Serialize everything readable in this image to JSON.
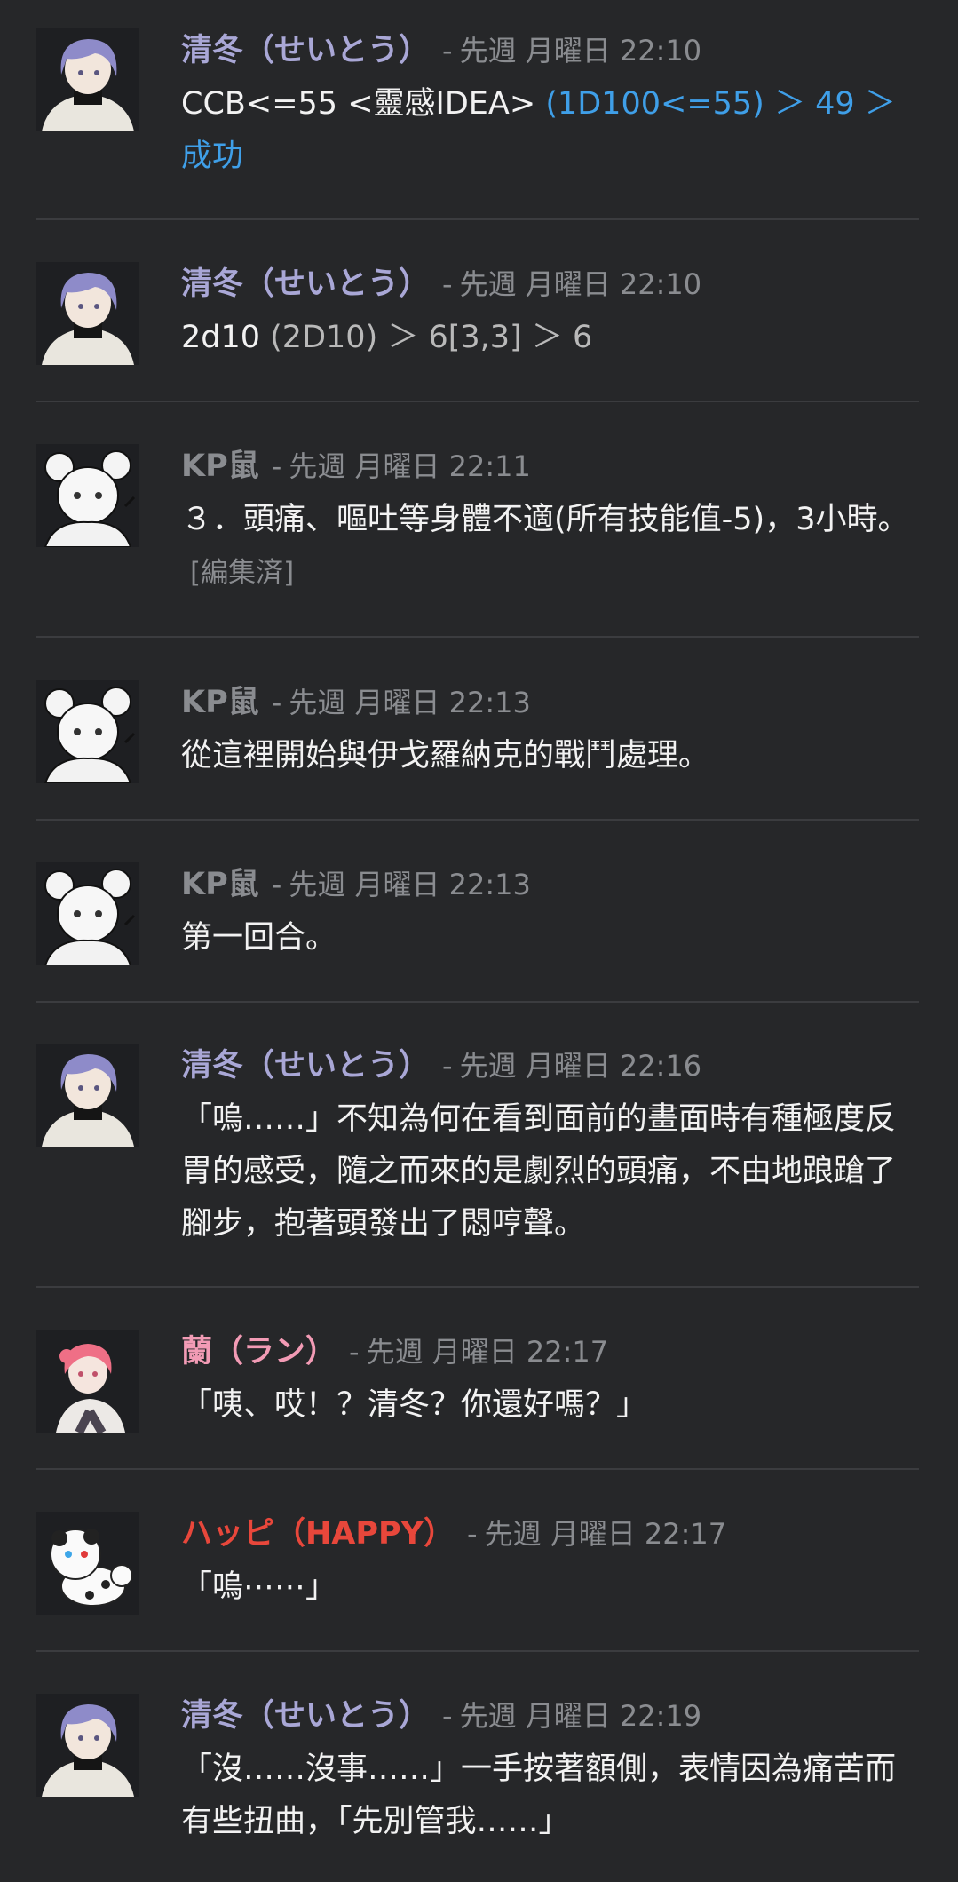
{
  "messages": [
    {
      "author": "清冬（せいとう）",
      "meta_dash": "-",
      "time": "先週 月曜日 22:10",
      "line_plain": "CCB<=55 <靈感IDEA> ",
      "line_roll": "(1D100<=55) ＞ 49 ＞ 成功",
      "author_color": "#a9a7d6"
    },
    {
      "author": "清冬（せいとう）",
      "meta_dash": "-",
      "time": "先週 月曜日 22:10",
      "line_plain": "2d10 ",
      "line_roll": "(2D10) ＞ 6[3,3] ＞ 6",
      "author_color": "#a9a7d6"
    },
    {
      "author": "KP鼠",
      "meta_dash": "-",
      "time": "先週 月曜日 22:11",
      "text": "３．頭痛、嘔吐等身體不適(所有技能值-5)，3小時。",
      "edited": "[編集済]",
      "author_color": "#8a8c90"
    },
    {
      "author": "KP鼠",
      "meta_dash": "-",
      "time": "先週 月曜日 22:13",
      "text": "從這裡開始與伊戈羅納克的戰鬥處理。",
      "author_color": "#8a8c90"
    },
    {
      "author": "KP鼠",
      "meta_dash": "-",
      "time": "先週 月曜日 22:13",
      "text": "第一回合。",
      "author_color": "#8a8c90"
    },
    {
      "author": "清冬（せいとう）",
      "meta_dash": "-",
      "time": "先週 月曜日 22:16",
      "text": "「嗚……」不知為何在看到面前的畫面時有種極度反胃的感受，隨之而來的是劇烈的頭痛，不由地踉蹌了腳步，抱著頭發出了悶哼聲。",
      "author_color": "#a9a7d6"
    },
    {
      "author": "蘭（ラン）",
      "meta_dash": "-",
      "time": "先週 月曜日 22:17",
      "text": "「咦、哎！？清冬？你還好嗎？」",
      "author_color": "#f29bb5"
    },
    {
      "author": "ハッピ（HAPPY）",
      "meta_dash": "-",
      "time": "先週 月曜日 22:17",
      "text": "「嗚⋯⋯」",
      "author_color": "#e8473b"
    },
    {
      "author": "清冬（せいとう）",
      "meta_dash": "-",
      "time": "先週 月曜日 22:19",
      "text": "「沒……沒事……」一手按著額側，表情因為痛苦而有些扭曲，「先別管我……」",
      "author_color": "#a9a7d6"
    }
  ],
  "colors": {
    "background": "#262729",
    "divider": "#3b3c3f",
    "roll_result": "#3f9fe8",
    "meta": "#8a8c90"
  },
  "avatars": [
    "seito-avatar",
    "kp-mouse-avatar",
    "ran-avatar",
    "happy-dog-avatar"
  ]
}
